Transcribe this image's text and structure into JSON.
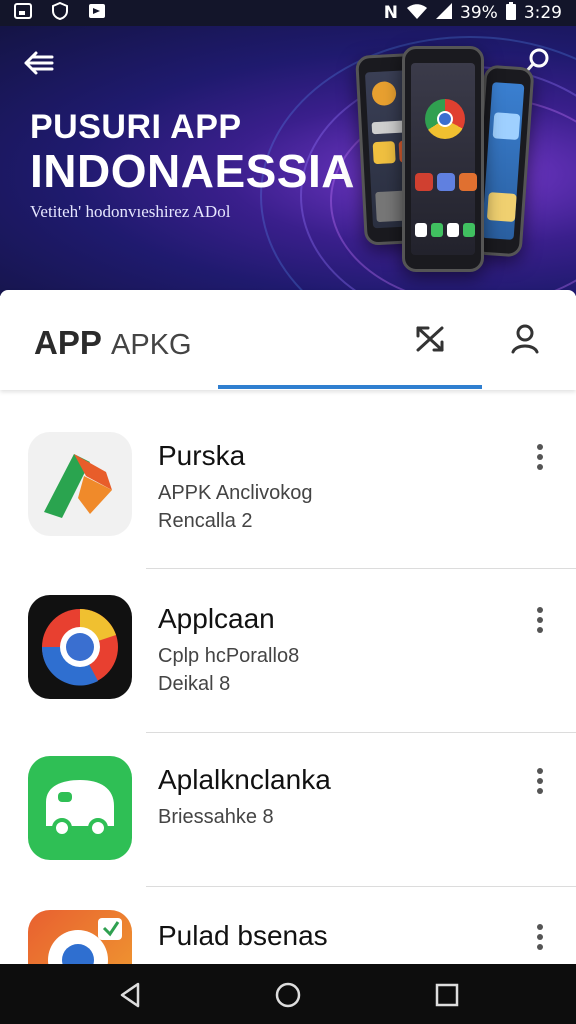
{
  "status_bar": {
    "left_icons": [
      "gallery-icon",
      "shield-icon",
      "flag-icon"
    ],
    "network": "N",
    "battery": "39%",
    "time": "3:29"
  },
  "hero": {
    "title_line1": "PUSURI APP",
    "title_line2": "INDONAESSIA",
    "subtitle": "Vetiteh' hodonvıeshirez ADol"
  },
  "tab_header": {
    "title_bold": "APP",
    "title_light": "APKG",
    "icons": [
      "crossed-arrows-icon",
      "user-icon"
    ]
  },
  "apps": [
    {
      "name": "Purska",
      "line1": "APPK Anclivokog",
      "line2": "Rencalla 2",
      "icon": "bookmark-icon"
    },
    {
      "name": "Applcaan",
      "line1": "Cplp hcPorallo8",
      "line2": "Deikal 8",
      "icon": "chrome-icon"
    },
    {
      "name": "Aplalknclanka",
      "line1": "Briessahke 8",
      "line2": "",
      "icon": "bus-icon"
    },
    {
      "name": "Pulad bsenas",
      "line1": "",
      "line2": "",
      "icon": "browser-icon"
    }
  ],
  "colors": {
    "accent": "#2f7fd0",
    "hero_dark": "#141445",
    "hero_purple": "#7a3bd0"
  }
}
